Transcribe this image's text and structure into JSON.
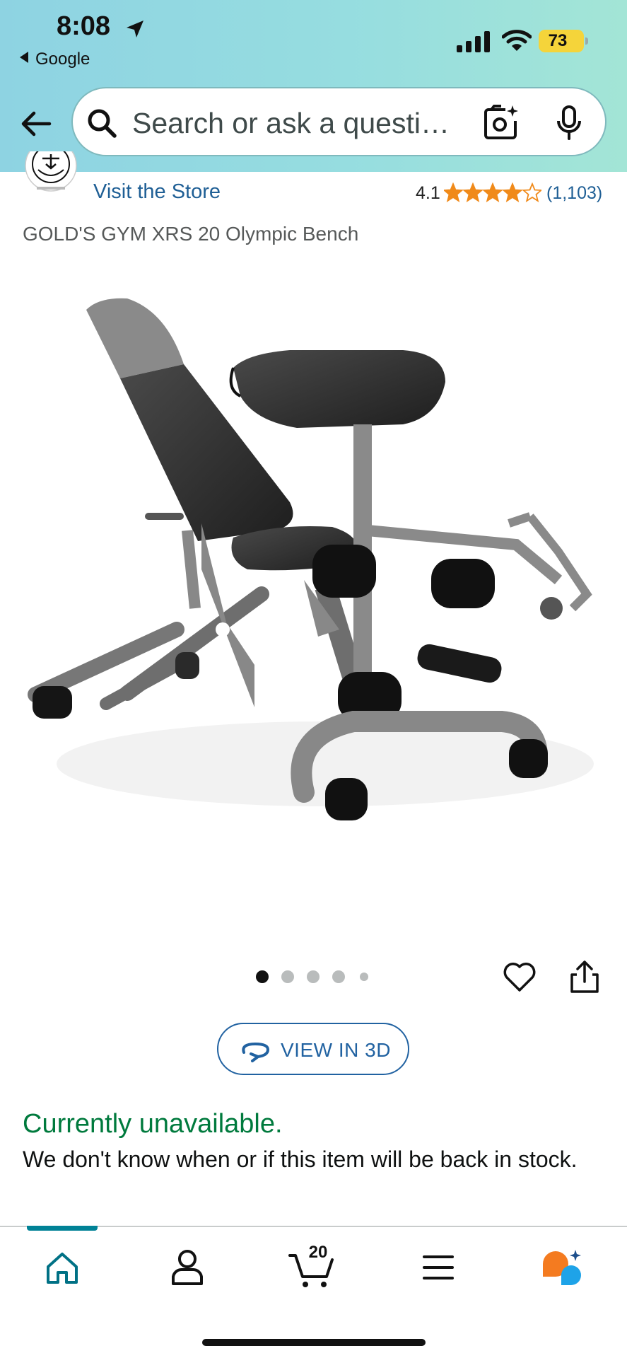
{
  "status_bar": {
    "time": "8:08",
    "back_app": "Google",
    "battery": "73",
    "icons": [
      "location-arrow-icon",
      "signal-icon",
      "wifi-icon",
      "battery-icon"
    ]
  },
  "search": {
    "placeholder": "Search or ask a questi…",
    "icons": [
      "back-arrow-icon",
      "search-icon",
      "camera-icon",
      "mic-icon"
    ]
  },
  "product": {
    "visit_store": "Visit the Store",
    "rating": "4.1",
    "rating_count": "(1,103)",
    "stars_value": 4.1,
    "title": "GOLD'S GYM XRS 20 Olympic Bench",
    "image_count": 5,
    "active_image": 1
  },
  "actions": {
    "view_3d": "VIEW IN 3D",
    "icons": [
      "heart-icon",
      "share-icon",
      "rotate-3d-icon"
    ]
  },
  "availability": {
    "title": "Currently unavailable.",
    "description": "We don't know when or if this item will be back in stock."
  },
  "bottom_nav": {
    "cart_count": "20",
    "items": [
      "home",
      "account",
      "cart",
      "menu",
      "rufus-ai"
    ],
    "active": "home"
  },
  "colors": {
    "header_gradient_start": "#8ed3e2",
    "header_gradient_end": "#a3e5d6",
    "link": "#1f5f95",
    "star": "#f08a1a",
    "available_green": "#007a3d",
    "active_nav": "#008296"
  }
}
